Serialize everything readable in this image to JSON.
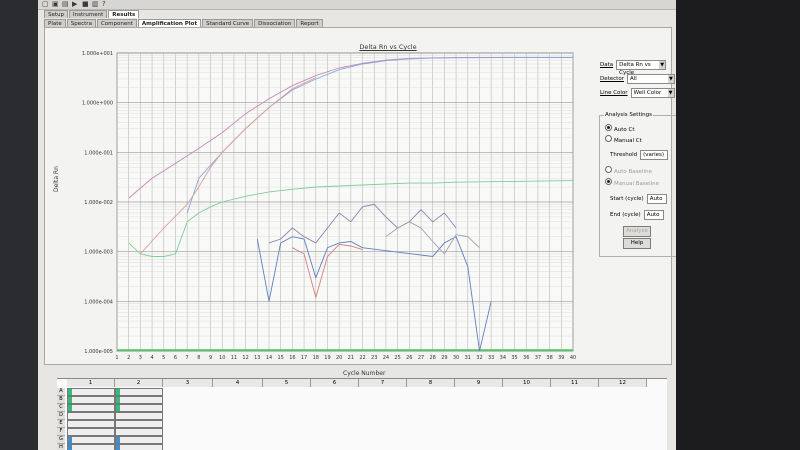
{
  "toolbar": {
    "icons": [
      "open-icon",
      "save-icon",
      "print-icon",
      "run-icon",
      "stop-icon",
      "report-icon",
      "help-icon"
    ]
  },
  "tabs_top": [
    "Setup",
    "Instrument",
    "Results"
  ],
  "tabs_bottom": [
    "Plate",
    "Spectra",
    "Component",
    "Amplification Plot",
    "Standard Curve",
    "Dissociation",
    "Report"
  ],
  "chart": {
    "title": "Delta Rn vs Cycle",
    "ylabel": "Delta Rn",
    "xlabel": "Cycle Number"
  },
  "side": {
    "data_label": "Data",
    "data_value": "Delta Rn vs Cycle",
    "detector_label": "Detector",
    "detector_value": "All",
    "linecolor_label": "Line Color",
    "linecolor_value": "Well Color",
    "analysis_title": "Analysis Settings",
    "auto_ct": "Auto Ct",
    "manual_ct": "Manual Ct",
    "threshold_label": "Threshold",
    "threshold_value": "(varies)",
    "auto_baseline": "Auto Baseline",
    "manual_baseline": "Manual Baseline",
    "start_label": "Start (cycle)",
    "start_value": "Auto",
    "end_label": "End (cycle)",
    "end_value": "Auto",
    "apply_label": "Analyze",
    "help_label": "Help"
  },
  "plate": {
    "columns": [
      "1",
      "2",
      "3",
      "4",
      "5",
      "6",
      "7",
      "8",
      "9",
      "10",
      "11",
      "12"
    ],
    "rows": [
      "A",
      "B",
      "C",
      "D",
      "E",
      "F",
      "G",
      "H"
    ]
  },
  "chart_data": {
    "type": "line",
    "title": "Delta Rn vs Cycle",
    "xlabel": "Cycle Number",
    "ylabel": "Delta Rn",
    "yscale": "log",
    "ylim": [
      1e-05,
      10
    ],
    "xlim": [
      1,
      40
    ],
    "y_ticks": [
      "1.000e+001",
      "1.000e+000",
      "1.000e-001",
      "1.000e-002",
      "1.000e-003",
      "1.000e-004",
      "1.000e-005"
    ],
    "x_ticks": [
      "1",
      "2",
      "3",
      "4",
      "5",
      "6",
      "7",
      "8",
      "9",
      "10",
      "11",
      "12",
      "13",
      "14",
      "15",
      "16",
      "17",
      "18",
      "19",
      "20",
      "21",
      "22",
      "23",
      "24",
      "25",
      "26",
      "27",
      "28",
      "29",
      "30",
      "31",
      "32",
      "33",
      "34",
      "35",
      "36",
      "37",
      "38",
      "39",
      "40"
    ],
    "grid": true,
    "series": [
      {
        "color": "#c58ab8",
        "x": [
          2,
          4,
          6,
          8,
          10,
          12,
          14,
          16,
          18,
          20,
          22,
          24,
          26,
          28,
          30,
          35,
          40
        ],
        "y": [
          0.012,
          0.03,
          0.06,
          0.12,
          0.25,
          0.6,
          1.2,
          2.2,
          3.5,
          5.0,
          6.2,
          7.2,
          7.8,
          8.0,
          8.1,
          8.2,
          8.2
        ]
      },
      {
        "color": "#8aa8d8",
        "x": [
          7,
          8,
          10,
          12,
          14,
          16,
          18,
          20,
          22,
          24,
          26,
          28,
          30,
          35,
          40
        ],
        "y": [
          0.006,
          0.03,
          0.1,
          0.3,
          0.8,
          1.8,
          3.0,
          4.6,
          6.0,
          7.0,
          7.6,
          7.9,
          8.0,
          8.1,
          8.1
        ]
      },
      {
        "color": "#7dcf96",
        "x": [
          2,
          3,
          4,
          5,
          6,
          7,
          8,
          9,
          10,
          12,
          14,
          16,
          18,
          20,
          22,
          24,
          26,
          28,
          30,
          35,
          40
        ],
        "y": [
          0.0015,
          0.0009,
          0.0008,
          0.0008,
          0.0009,
          0.004,
          0.006,
          0.008,
          0.01,
          0.013,
          0.016,
          0.018,
          0.02,
          0.021,
          0.022,
          0.023,
          0.024,
          0.024,
          0.025,
          0.026,
          0.027
        ]
      },
      {
        "color": "#d9a0a0",
        "x": [
          3,
          5,
          7,
          8,
          9,
          10,
          12,
          14,
          16,
          18
        ],
        "y": [
          0.0009,
          0.003,
          0.009,
          0.02,
          0.05,
          0.1,
          0.3,
          0.8,
          1.9,
          3.2
        ]
      },
      {
        "color": "#8c84b0",
        "x": [
          14,
          15,
          16,
          17,
          18,
          19,
          20,
          21,
          22,
          23,
          24,
          25,
          26,
          27,
          28,
          29,
          30
        ],
        "y": [
          0.0015,
          0.0018,
          0.003,
          0.002,
          0.0015,
          0.003,
          0.006,
          0.004,
          0.008,
          0.009,
          0.005,
          0.003,
          0.004,
          0.007,
          0.004,
          0.006,
          0.003
        ]
      },
      {
        "color": "#5d7fbf",
        "x": [
          13,
          14,
          15,
          16,
          17,
          18,
          19,
          20,
          21,
          22,
          28,
          29,
          30,
          31,
          32,
          33
        ],
        "y": [
          0.0018,
          0.0001,
          0.0015,
          0.002,
          0.0018,
          0.0003,
          0.0012,
          0.0015,
          0.0016,
          0.0012,
          0.0008,
          0.0015,
          0.002,
          0.0005,
          1e-05,
          0.0001
        ]
      },
      {
        "color": "#d68080",
        "x": [
          16,
          17,
          18,
          19,
          20,
          21,
          22
        ],
        "y": [
          0.0012,
          0.0009,
          0.00012,
          0.0008,
          0.0014,
          0.0013,
          0.0011
        ]
      },
      {
        "color": "#9da0a8",
        "x": [
          24,
          25,
          26,
          27,
          28,
          29,
          30,
          31,
          32
        ],
        "y": [
          0.002,
          0.003,
          0.004,
          0.003,
          0.0016,
          0.0009,
          0.0022,
          0.002,
          0.0012
        ]
      }
    ]
  }
}
